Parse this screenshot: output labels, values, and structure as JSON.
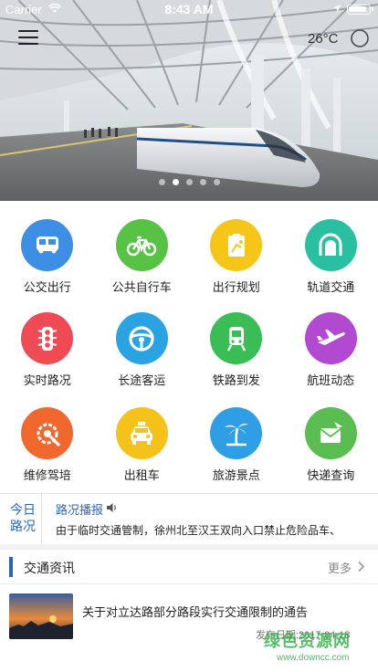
{
  "status_bar": {
    "carrier": "Carrier",
    "time": "8:43 AM"
  },
  "header": {
    "temperature": "26°C"
  },
  "banner": {
    "slide_count": 5,
    "active_index": 1
  },
  "services": [
    {
      "label": "公交出行",
      "icon": "bus-icon",
      "color": "#3d8fe5"
    },
    {
      "label": "公共自行车",
      "icon": "bicycle-icon",
      "color": "#58c244"
    },
    {
      "label": "出行规划",
      "icon": "route-plan-icon",
      "color": "#f5c518"
    },
    {
      "label": "轨道交通",
      "icon": "metro-tunnel-icon",
      "color": "#2bbfa2"
    },
    {
      "label": "实时路况",
      "icon": "traffic-light-icon",
      "color": "#ee4b55"
    },
    {
      "label": "长途客运",
      "icon": "steering-wheel-icon",
      "color": "#2aa3e3"
    },
    {
      "label": "铁路到发",
      "icon": "train-icon",
      "color": "#3bbd55"
    },
    {
      "label": "航班动态",
      "icon": "airplane-icon",
      "color": "#b24ad1"
    },
    {
      "label": "维修驾培",
      "icon": "repair-icon",
      "color": "#f0682e"
    },
    {
      "label": "出租车",
      "icon": "taxi-icon",
      "color": "#f5c21a"
    },
    {
      "label": "旅游景点",
      "icon": "palm-tree-icon",
      "color": "#2f9fe5"
    },
    {
      "label": "快递查询",
      "icon": "express-letter-icon",
      "color": "#5abd52"
    }
  ],
  "ticker": {
    "label": "今日路况",
    "label_line1": "今日",
    "label_line2": "路况",
    "title": "路况播报",
    "text": "由于临时交通管制，徐州北至汉王双向入口禁止危险品车、"
  },
  "traffic_news": {
    "title": "交通资讯",
    "more_label": "更多",
    "items": [
      {
        "title": "关于对立达路部分路段实行交通限制的通告",
        "date": "发布日期:2017-04-18"
      }
    ]
  },
  "watermark": {
    "text": "绿色资源网",
    "url": "www.downcc.com"
  }
}
